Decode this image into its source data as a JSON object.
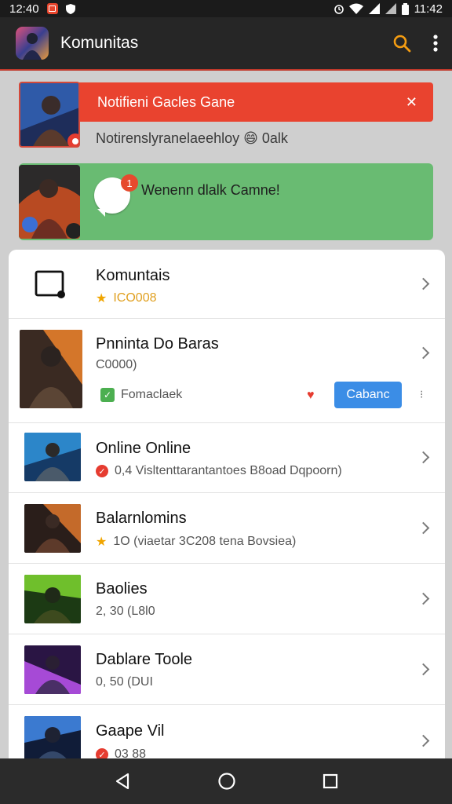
{
  "status_bar": {
    "time_left": "12:40",
    "time_right": "11:42"
  },
  "app_bar": {
    "title": "Komunitas",
    "search_icon": "search-icon",
    "menu_icon": "more-vert-icon",
    "accent_color": "#f39c12"
  },
  "notification_banner": {
    "title": "Notifieni Gacles Gane",
    "close_label": "✕",
    "subtitle": "Notirenslyranelaeehloy 😄 0alk",
    "color": "#e9432f"
  },
  "chat_banner": {
    "badge": "1",
    "text": "Wenenn dlalk Camne!",
    "color": "#69bb72"
  },
  "sheet": {
    "header": {
      "title": "Komuntais",
      "rating": "ICO008"
    },
    "featured": {
      "title": "Pnninta Do Baras",
      "subtitle": "C0000)",
      "tag": "Fomaclaek",
      "action": "Cabanc"
    },
    "items": [
      {
        "title": "Online Online",
        "meta": "0,4  Visltenttarantantoes B8oad Dqpoorn)"
      },
      {
        "title": "Balarnlomins",
        "meta": "1O  (viaetar 3C208 tena Bovsiea)"
      },
      {
        "title": "Baolies",
        "meta": "2, 30  (L8l0"
      },
      {
        "title": "Dablare Toole",
        "meta": "0, 50  (DUI"
      },
      {
        "title": "Gaape Vil",
        "meta": "03 88"
      }
    ]
  },
  "nav_bar": {
    "back_icon": "back-triangle-icon",
    "home_icon": "home-circle-icon",
    "recents_icon": "recents-square-icon"
  }
}
